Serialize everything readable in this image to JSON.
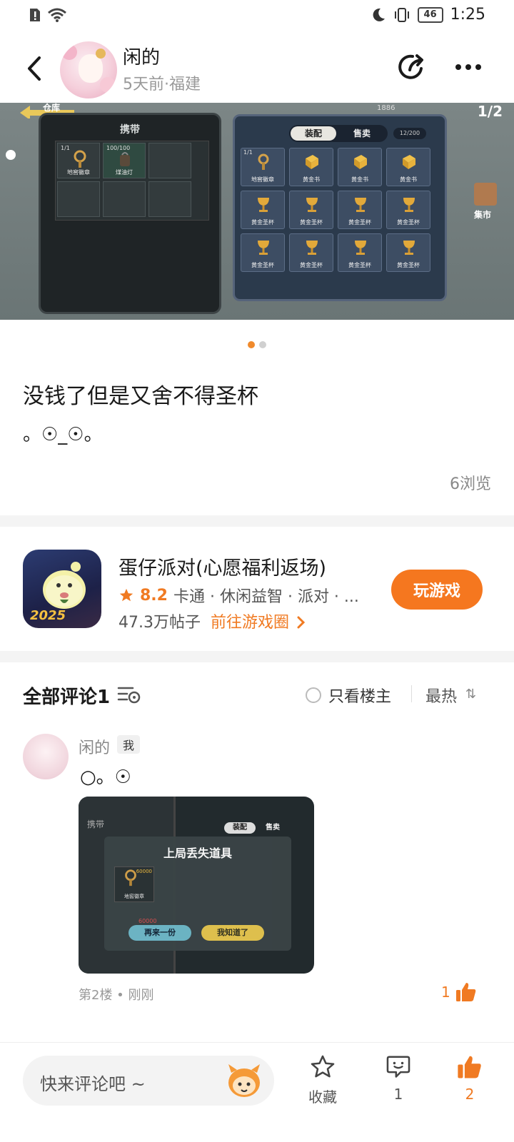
{
  "status_bar": {
    "time": "1:25",
    "battery": "46"
  },
  "header": {
    "author": "闲的",
    "meta": "5天前·福建"
  },
  "carousel": {
    "page_counter": "1/2",
    "game_screen": {
      "back_label": "仓库",
      "left_panel_title": "携带",
      "left_items": [
        {
          "count": "1/1",
          "label": "地窖徽章"
        },
        {
          "count": "100/100",
          "label": "煤油灯"
        }
      ],
      "tabs": [
        "装配",
        "售卖"
      ],
      "capacity": "12/200",
      "coins": "1886",
      "right_items": [
        {
          "label": "地窖徽章",
          "count": "1/1",
          "kind": "key"
        },
        {
          "label": "黄金书",
          "kind": "book"
        },
        {
          "label": "黄金书",
          "kind": "book"
        },
        {
          "label": "黄金书",
          "kind": "book"
        },
        {
          "label": "黄金圣杯",
          "kind": "cup"
        },
        {
          "label": "黄金圣杯",
          "kind": "cup"
        },
        {
          "label": "黄金圣杯",
          "kind": "cup"
        },
        {
          "label": "黄金圣杯",
          "kind": "cup"
        },
        {
          "label": "黄金圣杯",
          "kind": "cup"
        },
        {
          "label": "黄金圣杯",
          "kind": "cup"
        },
        {
          "label": "黄金圣杯",
          "kind": "cup"
        },
        {
          "label": "黄金圣杯",
          "kind": "cup"
        }
      ],
      "market_label": "集市"
    }
  },
  "post": {
    "title": "没钱了但是又舍不得圣杯",
    "body": "。☉_☉。",
    "views": "6浏览"
  },
  "game_card": {
    "name": "蛋仔派对(心愿福利返场)",
    "rating": "8.2",
    "tags": "卡通 · 休闲益智 · 派对 · ...",
    "posts": "47.3万帖子",
    "circle_link": "前往游戏圈",
    "play_label": "玩游戏",
    "icon_year": "2025"
  },
  "comments": {
    "header": "全部评论1",
    "only_op": "只看楼主",
    "sort": "最热",
    "items": [
      {
        "name": "闲的",
        "badge": "我",
        "text": "○。☉",
        "floor": "第2楼 • 刚刚",
        "likes": "1",
        "image": {
          "dialog_title": "上局丢失道具",
          "tab_1": "装配",
          "tab_2": "售卖",
          "panel": "携带",
          "item_label": "地窖徽章",
          "item_price": "60000",
          "price_2": "60000",
          "btn_retry": "再来一份",
          "btn_ok": "我知道了"
        }
      }
    ]
  },
  "bottom_bar": {
    "input_placeholder": "快来评论吧 ~",
    "favorite_label": "收藏",
    "comment_count": "1",
    "like_count": "2"
  },
  "colors": {
    "accent": "#f5771f",
    "accent_text": "#f07a22"
  }
}
